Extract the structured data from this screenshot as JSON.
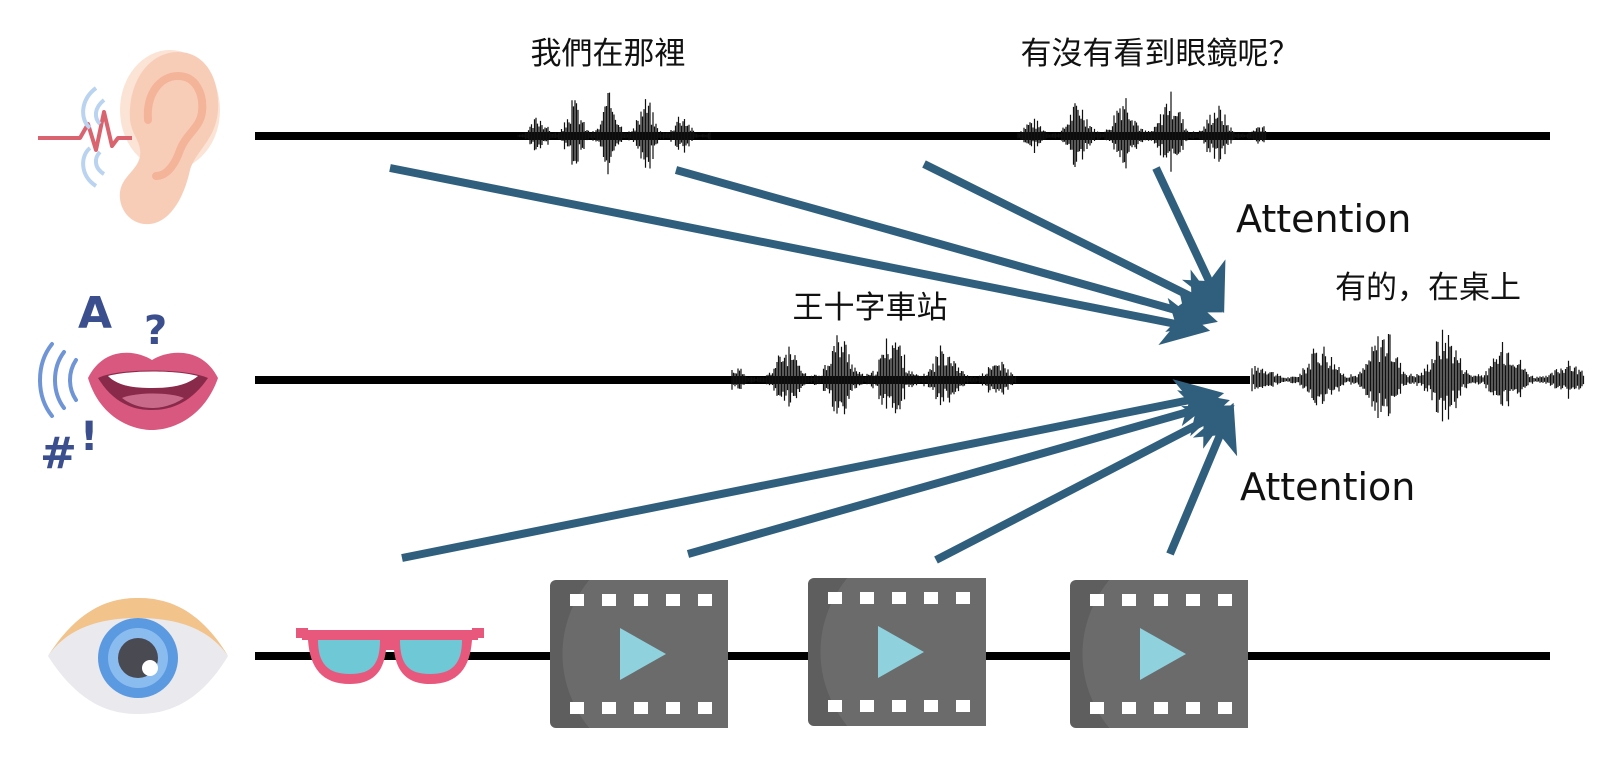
{
  "tracks": {
    "hearing": {
      "icon": "ear-icon",
      "utterances": [
        {
          "text": "我們在那裡"
        },
        {
          "text": "有沒有看到眼鏡呢？"
        }
      ]
    },
    "speaking": {
      "icon": "speaking-mouth-icon",
      "utterances": [
        {
          "text": "王十字車站"
        },
        {
          "text": "有的，在桌上"
        }
      ]
    },
    "vision": {
      "icon": "eye-icon",
      "objects": [
        "glasses-icon",
        "video-clip-icon",
        "video-clip-icon",
        "video-clip-icon"
      ]
    }
  },
  "attention_labels": {
    "audio": "Attention",
    "visual": "Attention"
  },
  "colors": {
    "arrow": "#305f7e",
    "timeline": "#000000",
    "waveform": "#111111",
    "ear_skin": "#f8cdb8",
    "ear_wave": "#d9646f",
    "lips": "#d9587f",
    "eye_iris": "#5b9ae0",
    "eye_lid": "#f2c38a",
    "glasses_frame": "#e8587c",
    "glasses_lens": "#6fc8d6",
    "film": "#5e5e5e",
    "play": "#8fd2de"
  }
}
